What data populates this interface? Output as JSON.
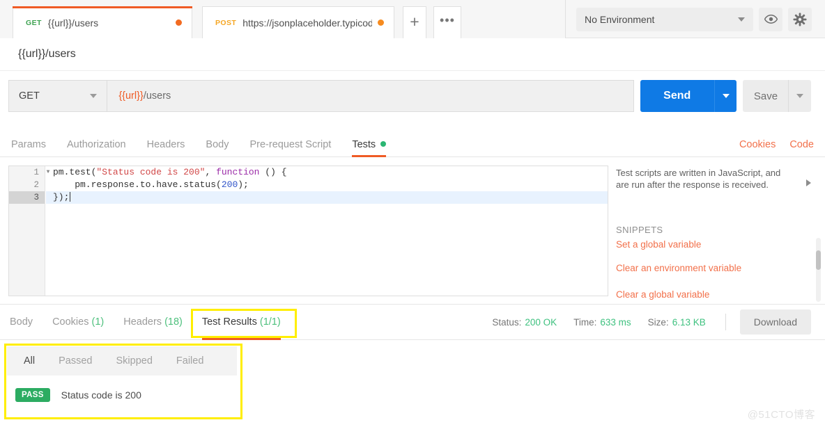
{
  "tabs": [
    {
      "method": "GET",
      "name": "{{url}}/users",
      "dirty": true,
      "active": true
    },
    {
      "method": "POST",
      "name": "https://jsonplaceholder.typicod",
      "dirty": true,
      "active": false
    }
  ],
  "tab_actions": {
    "new_tab": "+",
    "more": "•••"
  },
  "environment": {
    "selected": "No Environment",
    "eye_icon": "eye-icon",
    "gear_icon": "gear-icon"
  },
  "request": {
    "name": "{{url}}/users",
    "method": "GET",
    "url_variable": "{{url}}",
    "url_path": "/users",
    "send_label": "Send",
    "save_label": "Save"
  },
  "request_tabs": [
    {
      "label": "Params",
      "active": false,
      "dot": false
    },
    {
      "label": "Authorization",
      "active": false,
      "dot": false
    },
    {
      "label": "Headers",
      "active": false,
      "dot": false
    },
    {
      "label": "Body",
      "active": false,
      "dot": false
    },
    {
      "label": "Pre-request Script",
      "active": false,
      "dot": false
    },
    {
      "label": "Tests",
      "active": true,
      "dot": true
    }
  ],
  "request_tab_links": [
    {
      "label": "Cookies"
    },
    {
      "label": "Code"
    }
  ],
  "editor": {
    "lines": [
      {
        "no": "1",
        "foldable": true,
        "active": false
      },
      {
        "no": "2",
        "foldable": false,
        "active": false
      },
      {
        "no": "3",
        "foldable": false,
        "active": true
      }
    ],
    "code": {
      "l1_a": "pm.test(",
      "l1_str": "\"Status code is 200\"",
      "l1_b": ", ",
      "l1_kw": "function",
      "l1_c": " () {",
      "l2_a": "    pm.response.to.have.status(",
      "l2_num": "200",
      "l2_b": ");",
      "l3": "});"
    }
  },
  "snippets": {
    "description": "Test scripts are written in JavaScript, and are run after the response is received.",
    "heading": "SNIPPETS",
    "items": [
      "Set a global variable",
      "Clear an environment variable",
      "Clear a global variable"
    ]
  },
  "response_tabs": [
    {
      "label": "Body",
      "count": "",
      "active": false
    },
    {
      "label": "Cookies",
      "count": "(1)",
      "active": false
    },
    {
      "label": "Headers",
      "count": "(18)",
      "active": false
    },
    {
      "label": "Test Results",
      "count": "(1/1)",
      "active": true
    }
  ],
  "response_meta": [
    {
      "key": "Status:",
      "value": "200 OK"
    },
    {
      "key": "Time:",
      "value": "633 ms"
    },
    {
      "key": "Size:",
      "value": "6.13 KB"
    }
  ],
  "download_label": "Download",
  "test_results": {
    "filters": [
      {
        "label": "All",
        "active": true
      },
      {
        "label": "Passed",
        "active": false
      },
      {
        "label": "Skipped",
        "active": false
      },
      {
        "label": "Failed",
        "active": false
      }
    ],
    "rows": [
      {
        "status": "PASS",
        "name": "Status code is 200"
      }
    ]
  },
  "watermark": "@51CTO博客",
  "colors": {
    "accent_orange": "#ef5b25",
    "send_blue": "#0f7ae5",
    "pass_green": "#2cac62",
    "meta_green": "#3ec17f",
    "link_orange": "#f2704a",
    "highlight_yellow": "#ffee00"
  }
}
